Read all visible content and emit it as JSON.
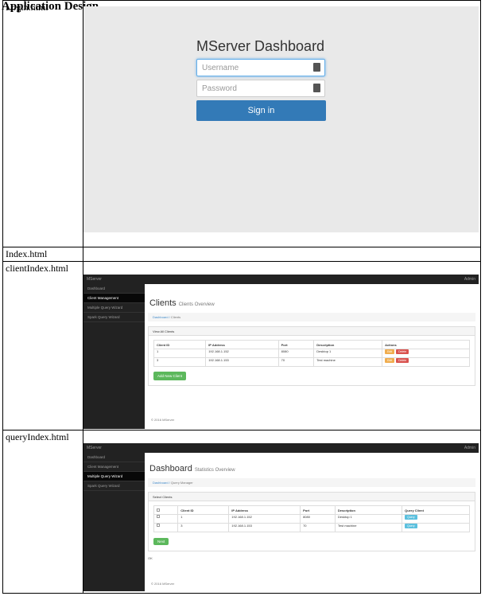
{
  "heading": "Application Design",
  "labels": {
    "login": "Login.html",
    "index": "Index.html",
    "client": "clientIndex.html",
    "query": "queryIndex.html"
  },
  "login": {
    "title": "MServer Dashboard",
    "username_placeholder": "Username",
    "password_placeholder": "Password",
    "signin": "Sign in"
  },
  "app": {
    "brand": "MServer",
    "admin": "Admin",
    "nav": [
      "Dashboard",
      "Client Management",
      "Multiple Query Wizard",
      "Spark Query Wizard"
    ],
    "footer": "© 2016 MServer"
  },
  "client": {
    "title": "Clients",
    "subtitle": "Clients Overview",
    "bc_home": "Dashboard",
    "bc_page": "Clients",
    "panel": "View All Clients",
    "columns": [
      "Client ID",
      "IP Address",
      "Port",
      "Description",
      "Actions"
    ],
    "rows": [
      {
        "id": "1",
        "ip": "192.168.1.152",
        "port": "8080",
        "desc": "Desktop 1"
      },
      {
        "id": "3",
        "ip": "192.168.1.153",
        "port": "70",
        "desc": "Test machine"
      }
    ],
    "edit": "Edit",
    "delete": "Delete",
    "add": "Add New Client"
  },
  "query": {
    "title": "Dashboard",
    "subtitle": "Statistics Overview",
    "bc_home": "Dashboard",
    "bc_page": "Query Manager",
    "panel": "Select Clients",
    "columns": [
      "Client ID",
      "IP Address",
      "Port",
      "Description",
      "Query Client"
    ],
    "rows": [
      {
        "id": "1",
        "ip": "192.168.1.152",
        "port": "8080",
        "desc": "Desktop 1"
      },
      {
        "id": "3",
        "ip": "192.168.1.153",
        "port": "70",
        "desc": "Test machine"
      }
    ],
    "query_btn": "Query",
    "next": "Next",
    "ok": "OK"
  }
}
